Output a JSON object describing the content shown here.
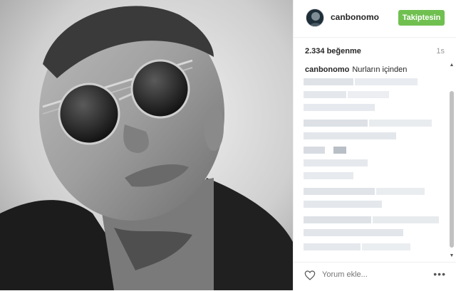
{
  "post": {
    "username": "canbonomo",
    "follow_label": "Takiptesin",
    "likes": "2.334 beğenme",
    "time": "1s",
    "caption_user": "canbonomo",
    "caption_text": "Nurların içinden"
  },
  "footer": {
    "comment_placeholder": "Yorum ekle...",
    "more_label": "•••"
  },
  "colors": {
    "follow_button": "#70c050",
    "blur": "#d9dde3"
  },
  "icons": {
    "heart": "heart-icon",
    "more": "more-options-icon"
  }
}
